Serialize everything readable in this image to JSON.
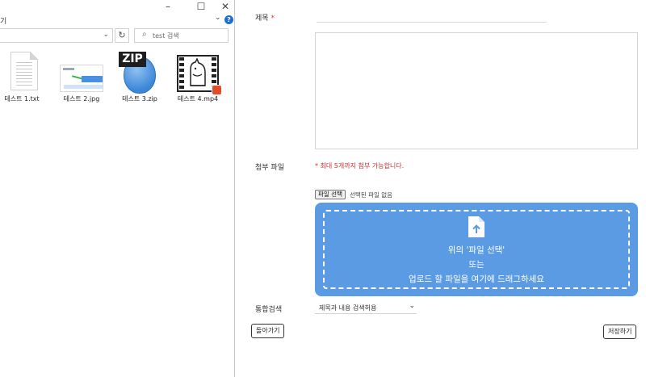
{
  "explorer": {
    "title_fragment": "기",
    "search": {
      "placeholder": "test 검색"
    },
    "files": [
      {
        "name": "테스트 1.txt",
        "icon": "txt-file-icon"
      },
      {
        "name": "테스트 2.jpg",
        "icon": "image-file-icon"
      },
      {
        "name": "테스트 3.zip",
        "icon": "zip-file-icon",
        "badge": "ZIP"
      },
      {
        "name": "테스트 4.mp4",
        "icon": "video-file-icon"
      }
    ],
    "caption_buttons": {
      "minimize": "–",
      "maximize": "☐",
      "close": "✕"
    },
    "help": "?"
  },
  "form": {
    "title_label": "제목",
    "required_mark": "*",
    "attach_label": "첨부 파일",
    "attach_note": "* 최대 5개까지 첨부 가능합니다.",
    "file_button": "파일 선택",
    "file_none": "선택된 파일 없음",
    "dropzone": {
      "line1": "위의 '파일 선택'",
      "line2": "또는",
      "line3": "업로드 할 파일을 여기에 드래그하세요"
    },
    "search_label": "통합검색",
    "search_option": "제목과 내용 검색허용",
    "back_button": "돌아가기",
    "save_button": "저장하기"
  },
  "colors": {
    "dropzone_bg": "#5b9be4",
    "required": "#d0302b",
    "help_icon": "#1a6fd4"
  }
}
